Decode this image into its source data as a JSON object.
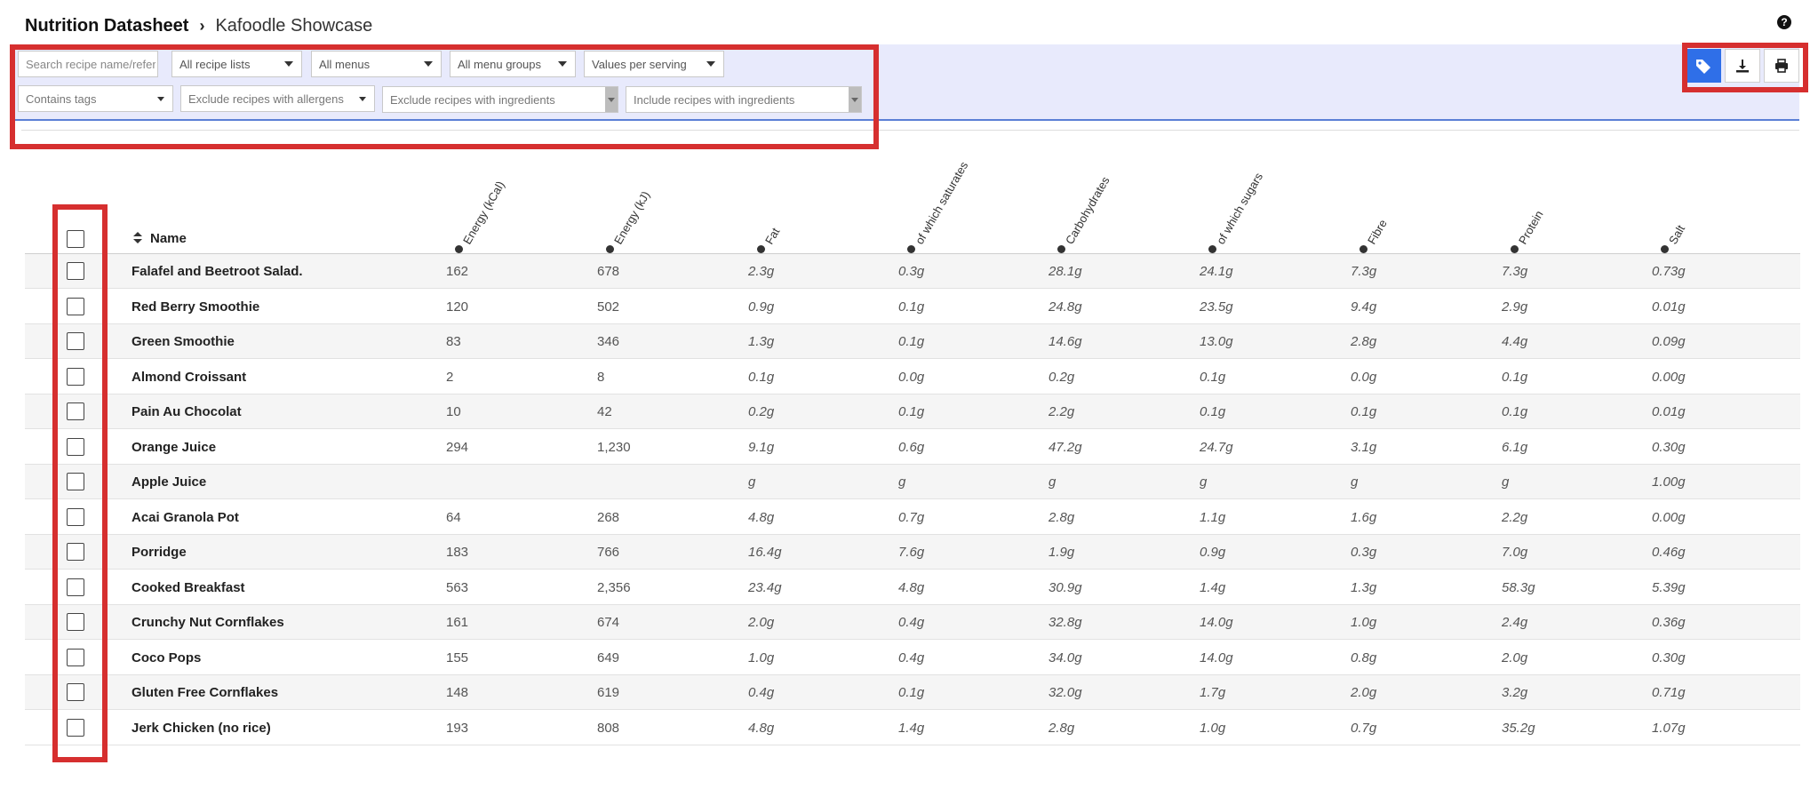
{
  "breadcrumb": {
    "root": "Nutrition Datasheet",
    "separator": "›",
    "current": "Kafoodle Showcase"
  },
  "help_icon": "question-circle-icon",
  "filters": {
    "search_placeholder": "Search recipe name/reference",
    "recipe_lists": "All recipe lists",
    "menus": "All menus",
    "menu_groups": "All menu groups",
    "values_mode": "Values per serving",
    "contains_tags": "Contains tags",
    "exclude_allergens": "Exclude recipes with allergens",
    "exclude_ingredients": "Exclude recipes with ingredients",
    "include_ingredients": "Include recipes with ingredients"
  },
  "toolbar": {
    "tag_icon": "tag-icon",
    "download_icon": "download-icon",
    "print_icon": "print-icon"
  },
  "accent_color": "#2f6fe8",
  "highlight_color": "#d62f2f",
  "table": {
    "name_header": "Name",
    "columns": [
      "Energy (kCal)",
      "Energy (kJ)",
      "Fat",
      "of which saturates",
      "Carbohydrates",
      "of which sugars",
      "Fibre",
      "Protein",
      "Salt"
    ],
    "rows": [
      {
        "name": "Falafel and Beetroot Salad.",
        "values": [
          "162",
          "678",
          "2.3g",
          "0.3g",
          "28.1g",
          "24.1g",
          "7.3g",
          "7.3g",
          "0.73g"
        ]
      },
      {
        "name": "Red Berry Smoothie",
        "values": [
          "120",
          "502",
          "0.9g",
          "0.1g",
          "24.8g",
          "23.5g",
          "9.4g",
          "2.9g",
          "0.01g"
        ]
      },
      {
        "name": "Green Smoothie",
        "values": [
          "83",
          "346",
          "1.3g",
          "0.1g",
          "14.6g",
          "13.0g",
          "2.8g",
          "4.4g",
          "0.09g"
        ]
      },
      {
        "name": "Almond Croissant",
        "values": [
          "2",
          "8",
          "0.1g",
          "0.0g",
          "0.2g",
          "0.1g",
          "0.0g",
          "0.1g",
          "0.00g"
        ]
      },
      {
        "name": "Pain Au Chocolat",
        "values": [
          "10",
          "42",
          "0.2g",
          "0.1g",
          "2.2g",
          "0.1g",
          "0.1g",
          "0.1g",
          "0.01g"
        ]
      },
      {
        "name": "Orange Juice",
        "values": [
          "294",
          "1,230",
          "9.1g",
          "0.6g",
          "47.2g",
          "24.7g",
          "3.1g",
          "6.1g",
          "0.30g"
        ]
      },
      {
        "name": "Apple Juice",
        "values": [
          "",
          "",
          "g",
          "g",
          "g",
          "g",
          "g",
          "g",
          "1.00g"
        ]
      },
      {
        "name": "Acai Granola Pot",
        "values": [
          "64",
          "268",
          "4.8g",
          "0.7g",
          "2.8g",
          "1.1g",
          "1.6g",
          "2.2g",
          "0.00g"
        ]
      },
      {
        "name": "Porridge",
        "values": [
          "183",
          "766",
          "16.4g",
          "7.6g",
          "1.9g",
          "0.9g",
          "0.3g",
          "7.0g",
          "0.46g"
        ]
      },
      {
        "name": "Cooked Breakfast",
        "values": [
          "563",
          "2,356",
          "23.4g",
          "4.8g",
          "30.9g",
          "1.4g",
          "1.3g",
          "58.3g",
          "5.39g"
        ]
      },
      {
        "name": "Crunchy Nut Cornflakes",
        "values": [
          "161",
          "674",
          "2.0g",
          "0.4g",
          "32.8g",
          "14.0g",
          "1.0g",
          "2.4g",
          "0.36g"
        ]
      },
      {
        "name": "Coco Pops",
        "values": [
          "155",
          "649",
          "1.0g",
          "0.4g",
          "34.0g",
          "14.0g",
          "0.8g",
          "2.0g",
          "0.30g"
        ]
      },
      {
        "name": "Gluten Free Cornflakes",
        "values": [
          "148",
          "619",
          "0.4g",
          "0.1g",
          "32.0g",
          "1.7g",
          "2.0g",
          "3.2g",
          "0.71g"
        ]
      },
      {
        "name": "Jerk Chicken (no rice)",
        "values": [
          "193",
          "808",
          "4.8g",
          "1.4g",
          "2.8g",
          "1.0g",
          "0.7g",
          "35.2g",
          "1.07g"
        ]
      }
    ]
  }
}
